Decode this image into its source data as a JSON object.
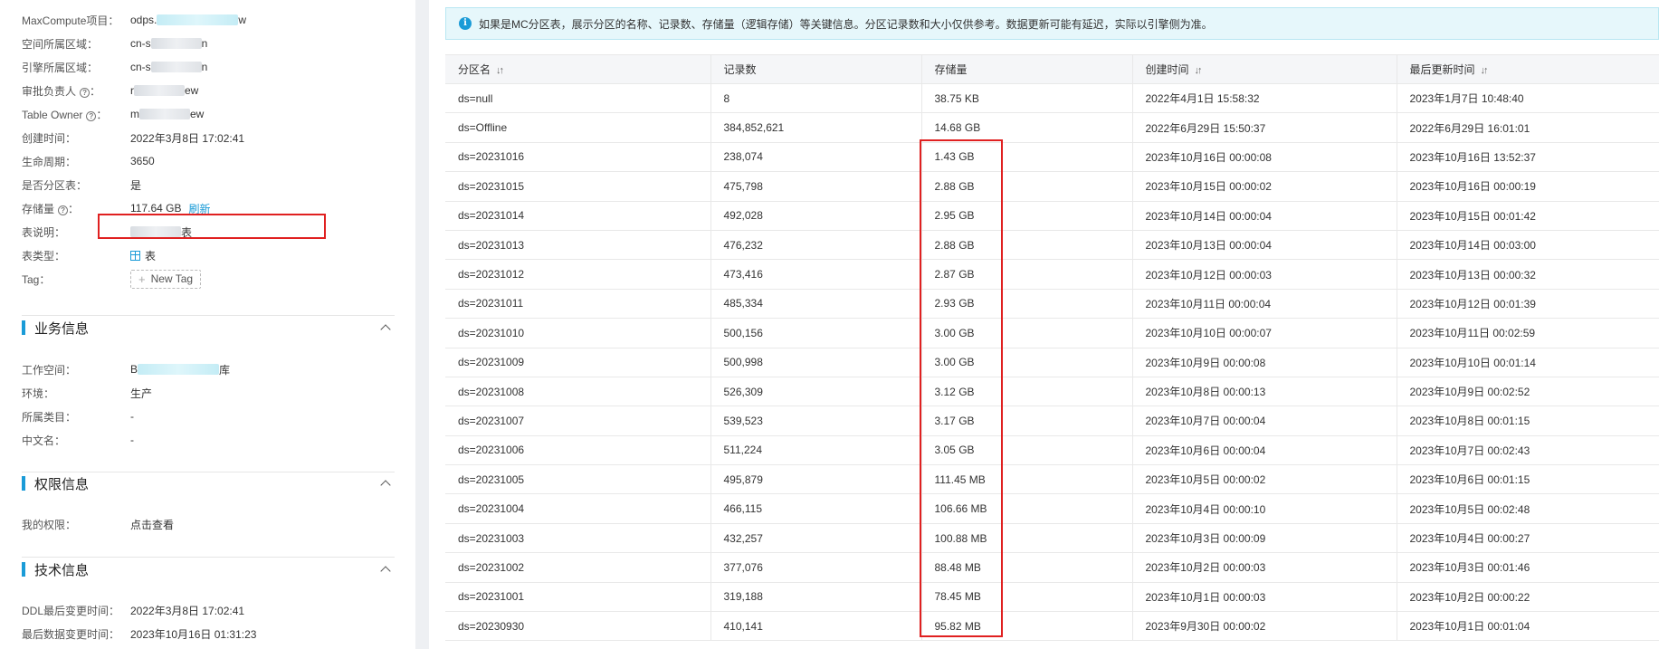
{
  "left": {
    "props": [
      {
        "key": "MaxCompute项目：",
        "value_prefix": "odps.",
        "value_suffix": "w",
        "link": true
      },
      {
        "key": "空间所属区域：",
        "value_prefix": "cn-s",
        "value_suffix": "n"
      },
      {
        "key": "引擎所属区域：",
        "value_prefix": "cn-s",
        "value_suffix": "n"
      },
      {
        "key": "审批负责人",
        "value_prefix": "r",
        "value_suffix": "ew",
        "info": true
      },
      {
        "key": "Table Owner",
        "value_prefix": "m",
        "value_suffix": "ew",
        "info": true
      },
      {
        "key": "创建时间：",
        "value": "2022年3月8日 17:02:41"
      },
      {
        "key": "生命周期：",
        "value": "3650"
      },
      {
        "key": "是否分区表：",
        "value": "是"
      },
      {
        "key": "存储量",
        "value": "117.64 GB",
        "info": true,
        "action": "刷新"
      },
      {
        "key": "表说明：",
        "value_suffix": "表"
      },
      {
        "key": "表类型：",
        "value": "表",
        "icon": "table-icon"
      },
      {
        "key": "Tag：",
        "button": "New Tag"
      }
    ],
    "business": {
      "title": "业务信息",
      "items": [
        {
          "key": "工作空间：",
          "value_prefix": "B",
          "value_suffix": "库",
          "link": true
        },
        {
          "key": "环境：",
          "value": "生产"
        },
        {
          "key": "所属类目：",
          "value": "-"
        },
        {
          "key": "中文名：",
          "value": "-"
        }
      ]
    },
    "permission": {
      "title": "权限信息",
      "items": [
        {
          "key": "我的权限：",
          "value": "点击查看",
          "link": true
        }
      ]
    },
    "tech": {
      "title": "技术信息",
      "items": [
        {
          "key": "DDL最后变更时间：",
          "value": "2022年3月8日 17:02:41"
        },
        {
          "key": "最后数据变更时间：",
          "value": "2023年10月16日 01:31:23"
        }
      ]
    }
  },
  "notice": "如果是MC分区表，展示分区的名称、记录数、存储量（逻辑存储）等关键信息。分区记录数和大小仅供参考。数据更新可能有延迟，实际以引擎侧为准。",
  "table": {
    "headers": [
      "分区名",
      "记录数",
      "存储量",
      "创建时间",
      "最后更新时间"
    ],
    "sortable": [
      true,
      false,
      false,
      true,
      true
    ],
    "rows": [
      [
        "ds=null",
        "8",
        "38.75 KB",
        "2022年4月1日 15:58:32",
        "2023年1月7日 10:48:40"
      ],
      [
        "ds=Offline",
        "384,852,621",
        "14.68 GB",
        "2022年6月29日 15:50:37",
        "2022年6月29日 16:01:01"
      ],
      [
        "ds=20231016",
        "238,074",
        "1.43 GB",
        "2023年10月16日 00:00:08",
        "2023年10月16日 13:52:37"
      ],
      [
        "ds=20231015",
        "475,798",
        "2.88 GB",
        "2023年10月15日 00:00:02",
        "2023年10月16日 00:00:19"
      ],
      [
        "ds=20231014",
        "492,028",
        "2.95 GB",
        "2023年10月14日 00:00:04",
        "2023年10月15日 00:01:42"
      ],
      [
        "ds=20231013",
        "476,232",
        "2.88 GB",
        "2023年10月13日 00:00:04",
        "2023年10月14日 00:03:00"
      ],
      [
        "ds=20231012",
        "473,416",
        "2.87 GB",
        "2023年10月12日 00:00:03",
        "2023年10月13日 00:00:32"
      ],
      [
        "ds=20231011",
        "485,334",
        "2.93 GB",
        "2023年10月11日 00:00:04",
        "2023年10月12日 00:01:39"
      ],
      [
        "ds=20231010",
        "500,156",
        "3.00 GB",
        "2023年10月10日 00:00:07",
        "2023年10月11日 00:02:59"
      ],
      [
        "ds=20231009",
        "500,998",
        "3.00 GB",
        "2023年10月9日 00:00:08",
        "2023年10月10日 00:01:14"
      ],
      [
        "ds=20231008",
        "526,309",
        "3.12 GB",
        "2023年10月8日 00:00:13",
        "2023年10月9日 00:02:52"
      ],
      [
        "ds=20231007",
        "539,523",
        "3.17 GB",
        "2023年10月7日 00:00:04",
        "2023年10月8日 00:01:15"
      ],
      [
        "ds=20231006",
        "511,224",
        "3.05 GB",
        "2023年10月6日 00:00:04",
        "2023年10月7日 00:02:43"
      ],
      [
        "ds=20231005",
        "495,879",
        "111.45 MB",
        "2023年10月5日 00:00:02",
        "2023年10月6日 00:01:15"
      ],
      [
        "ds=20231004",
        "466,115",
        "106.66 MB",
        "2023年10月4日 00:00:10",
        "2023年10月5日 00:02:48"
      ],
      [
        "ds=20231003",
        "432,257",
        "100.88 MB",
        "2023年10月3日 00:00:09",
        "2023年10月4日 00:00:27"
      ],
      [
        "ds=20231002",
        "377,076",
        "88.48 MB",
        "2023年10月2日 00:00:03",
        "2023年10月3日 00:01:46"
      ],
      [
        "ds=20231001",
        "319,188",
        "78.45 MB",
        "2023年10月1日 00:00:03",
        "2023年10月2日 00:00:22"
      ],
      [
        "ds=20230930",
        "410,141",
        "95.82 MB",
        "2023年9月30日 00:00:02",
        "2023年10月1日 00:01:04"
      ]
    ]
  },
  "colors": {
    "accent": "#1a9bd7",
    "highlight": "#e02020"
  }
}
